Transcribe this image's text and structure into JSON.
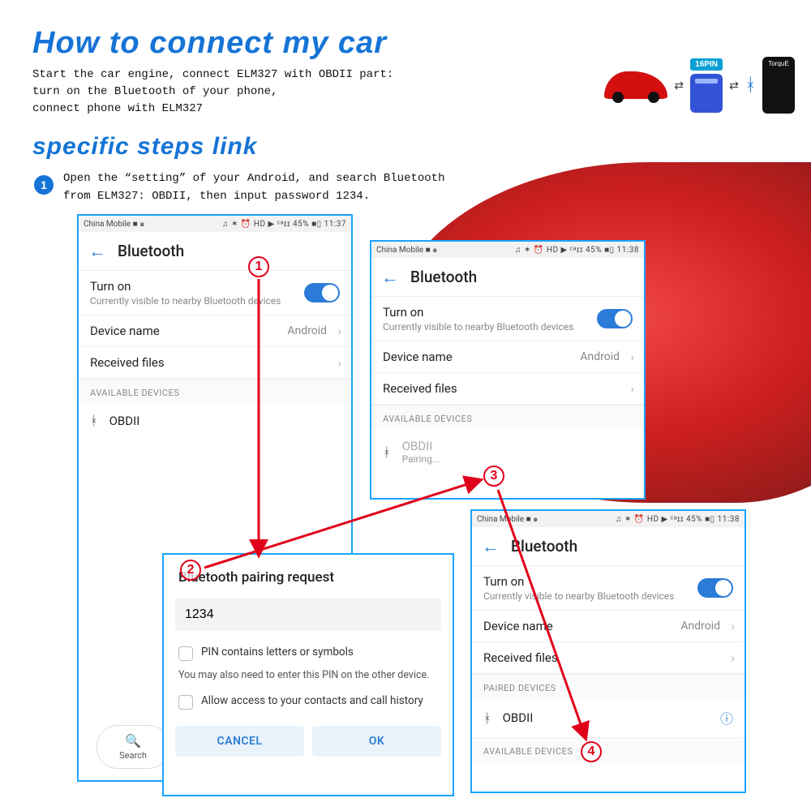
{
  "header": {
    "title1": "How to connect my car",
    "intro": "Start the car engine, connect ELM327 with OBDII part:\nturn on the Bluetooth of your phone,\nconnect phone with ELM327",
    "title2": "specific steps link",
    "pin_badge": "16PIN",
    "phone_label": "TorquE"
  },
  "step": {
    "num": "1",
    "text": "Open the “setting” of your Android, and search Bluetooth\nfrom ELM327: OBDII, then input password 1234."
  },
  "status": {
    "carrier": "China Mobile ■ ๑",
    "right_a": "♫ ✶ ⏰ HD ▶ ᶜᵃɪɪ 45% ■▯ 11:37",
    "right_b": "♫ ✶ ⏰ HD ▶ ᶜᵃɪɪ 45% ■▯ 11:38"
  },
  "bt": {
    "title": "Bluetooth",
    "turn_on": "Turn on",
    "visible": "Currently visible to nearby Bluetooth devices",
    "device_name": "Device name",
    "android": "Android",
    "received": "Received files",
    "available": "AVAILABLE DEVICES",
    "paired": "PAIRED DEVICES",
    "obdii": "OBDII",
    "pairing": "Pairing...",
    "search": "Search"
  },
  "dialog": {
    "title": "Bluetooth pairing request",
    "pin": "1234",
    "chk1": "PIN contains letters or symbols",
    "note": "You may also need to enter this PIN on the other device.",
    "chk2": "Allow access to your contacts and call history",
    "cancel": "CANCEL",
    "ok": "OK"
  },
  "callouts": {
    "c1": "1",
    "c2": "2",
    "c3": "3",
    "c4": "4"
  }
}
